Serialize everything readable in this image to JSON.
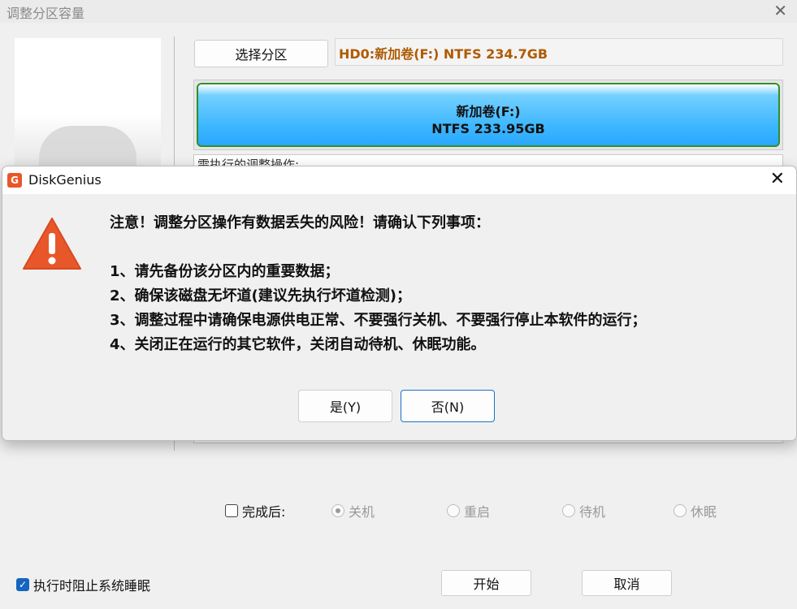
{
  "main_window": {
    "title": "调整分区容量",
    "select_partition_label": "选择分区",
    "partition_info": "HD0:新加卷(F:) NTFS 234.7GB",
    "disk_bar": {
      "label": "新加卷(F:)",
      "size": "NTFS 233.95GB"
    },
    "ops_label": "需执行的调整操作:",
    "options": {
      "after_label": "完成后:",
      "choices": [
        "关机",
        "重启",
        "待机",
        "休眠"
      ],
      "selected": "关机"
    },
    "prevent_sleep_label": "执行时阻止系统睡眠",
    "start_label": "开始",
    "cancel_label": "取消"
  },
  "dialog": {
    "title": "DiskGenius",
    "heading": "注意！调整分区操作有数据丢失的风险！请确认下列事项：",
    "items": [
      "1、请先备份该分区内的重要数据；",
      "2、确保该磁盘无坏道(建议先执行坏道检测)；",
      "3、调整过程中请确保电源供电正常、不要强行关机、不要强行停止本软件的运行；",
      "4、关闭正在运行的其它软件，关闭自动待机、休眠功能。"
    ],
    "yes_label": "是(Y)",
    "no_label": "否(N)"
  },
  "colors": {
    "partition_text": "#b05a00",
    "disk_bar": "#3cb6ff",
    "warning": "#e8572a",
    "accent": "#1565c0"
  },
  "icons": [
    "close-icon",
    "warning-icon",
    "diskgenius-logo-icon",
    "checkbox-icon",
    "radio-icon"
  ]
}
